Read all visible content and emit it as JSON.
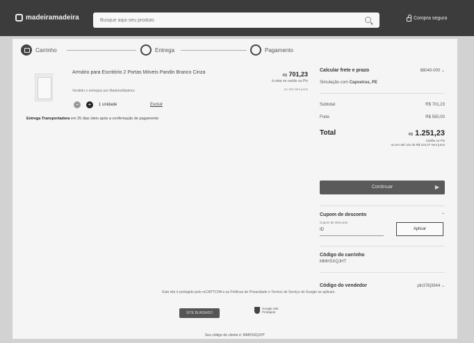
{
  "header": {
    "logo": "madeiramadeira",
    "search_placeholder": "Busque aqui seu produto",
    "secure_label": "Compra segura"
  },
  "steps": [
    {
      "label": "Carrinho"
    },
    {
      "label": "Entrega"
    },
    {
      "label": "Pagamento"
    }
  ],
  "cart": {
    "product_name": "Armário para Escritório 2 Portas Móveis Pandin Branco Cinza",
    "seller": "Vendido e entregue por MadeiraMadeira",
    "quantity": "1 unidade",
    "remove": "Excluir",
    "price": "701,23",
    "price_prefix": "R$",
    "price_sub": "à vista no cartão ou Pix",
    "price_note": "ou 10x sem juros",
    "delivery_bold": "Entrega Transportadora",
    "delivery_rest": "em 25 dias úteis após a confirmação do pagamento"
  },
  "summary": {
    "shipping_label": "Calcular frete e prazo",
    "cep_value": "88040-000",
    "sim_label": "Simulação com",
    "sim_city": "Capoeiras, PE",
    "subtotal_label": "Subtotal",
    "subtotal_value": "R$ 701,23",
    "frete_label": "Frete",
    "frete_value": "R$ 550,00",
    "total_label": "Total",
    "total_value": "1.251,23",
    "total_prefix": "R$",
    "total_note1": "Cartão ou Pix",
    "total_note2": "ou em até 12x de R$ 104,27 sem juros",
    "continue_label": "Continuar",
    "coupon_title": "Cupom de desconto",
    "coupon_field_label": "Cupom de desconto",
    "coupon_value": "ID",
    "apply_label": "Aplicar",
    "cart_code_title": "Código do carrinho",
    "cart_code_value": "MMHSXQJHT",
    "seller_code_title": "Código do vendedor",
    "seller_code_value": "pln376|3944"
  },
  "footer": {
    "notice": "Este site é protegido pelo reCAPTCHA e as Políticas de Privacidade e Termos de Serviço do Google se aplicam.",
    "seal1": "SITE BLINDADO",
    "seal2": "Google Site Protegido",
    "bottom": "Seu código de cliente é: MMHSXQJHT"
  }
}
